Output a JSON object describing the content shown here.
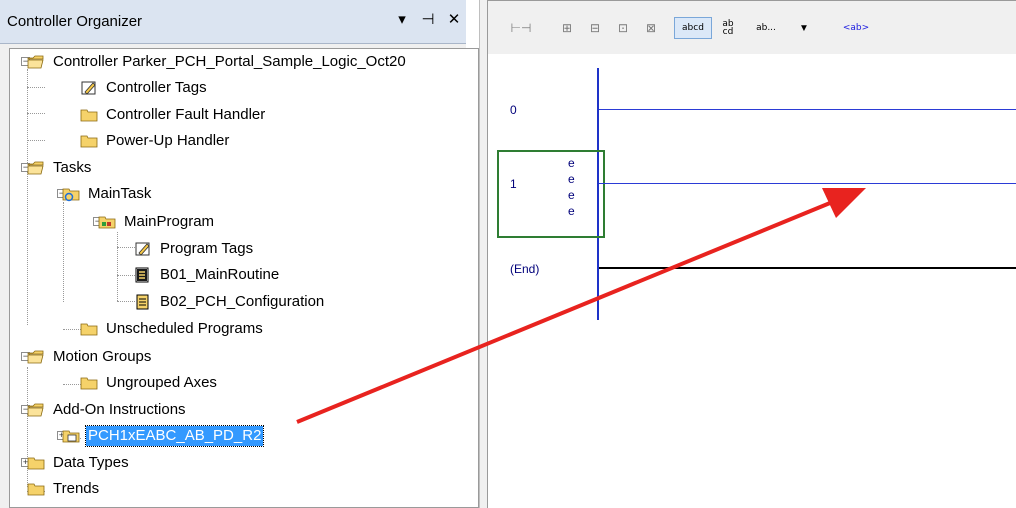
{
  "organizer": {
    "title": "Controller Organizer",
    "header_buttons": {
      "dropdown": "▾",
      "pin": "⊣",
      "close": "✕"
    },
    "tree": [
      {
        "label": "Controller Parker_PCH_Portal_Sample_Logic_Oct20",
        "icon": "folder-open-icon",
        "expander": "−"
      },
      {
        "label": "Controller Tags",
        "icon": "tags-icon"
      },
      {
        "label": "Controller Fault Handler",
        "icon": "folder-icon"
      },
      {
        "label": "Power-Up Handler",
        "icon": "folder-icon"
      },
      {
        "label": "Tasks",
        "icon": "folder-open-icon",
        "expander": "−"
      },
      {
        "label": "MainTask",
        "icon": "task-icon",
        "expander": "−"
      },
      {
        "label": "MainProgram",
        "icon": "program-icon",
        "expander": "−"
      },
      {
        "label": "Program Tags",
        "icon": "tags-icon"
      },
      {
        "label": "B01_MainRoutine",
        "icon": "main-routine-icon"
      },
      {
        "label": "B02_PCH_Configuration",
        "icon": "routine-icon"
      },
      {
        "label": "Unscheduled Programs",
        "icon": "folder-icon"
      },
      {
        "label": "Motion Groups",
        "icon": "folder-open-icon",
        "expander": "−"
      },
      {
        "label": "Ungrouped Axes",
        "icon": "folder-icon"
      },
      {
        "label": "Add-On Instructions",
        "icon": "folder-open-icon",
        "expander": "−"
      },
      {
        "label": "PCH1xEABC_AB_PD_R2",
        "icon": "aoi-icon",
        "expander": "+",
        "selected": true
      },
      {
        "label": "Data Types",
        "icon": "folder-icon",
        "expander": "+"
      },
      {
        "label": "Trends",
        "icon": "folder-icon"
      }
    ]
  },
  "toolbar": {
    "buttons": [
      {
        "name": "rung-insert-icon",
        "glyph": "⊢⊣"
      },
      {
        "name": "branch-icon",
        "glyph": "⊞"
      },
      {
        "name": "branch-level-icon",
        "glyph": "⊟"
      },
      {
        "name": "xic-icon",
        "glyph": "⊡"
      },
      {
        "name": "xio-icon",
        "glyph": "⊠"
      }
    ],
    "text_buttons": {
      "abcd": "abcd",
      "abcd_stacked_top": "ab",
      "abcd_stacked_bottom": "cd",
      "ab_ellipsis": "ab...",
      "ab_tag": "<ab>"
    },
    "dropdown": "▼"
  },
  "ladder": {
    "rungs": [
      {
        "number": "0"
      },
      {
        "number": "1",
        "errors": [
          "e",
          "e",
          "e",
          "e"
        ]
      },
      {
        "number": "(End)"
      }
    ]
  },
  "colors": {
    "selection": "#3399ff",
    "rail": "#1e33c8",
    "error_box": "#2e7d32",
    "arrow": "#e8231f",
    "folder": "#f5d26a"
  }
}
